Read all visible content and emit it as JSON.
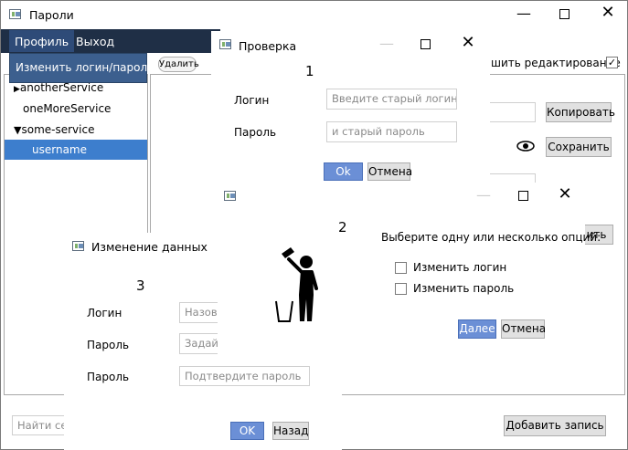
{
  "main": {
    "title": "Пароли",
    "menu": {
      "profile": "Профиль",
      "exit": "Выход"
    },
    "dropdown_item": "Изменить логин/пароль",
    "delete_button": "Удалить",
    "allow_edit_label": "шить редактирование",
    "tree": [
      {
        "label": "anotherService",
        "prefix": "▶"
      },
      {
        "label": "oneMoreService",
        "prefix": ""
      },
      {
        "label": "some-service",
        "prefix": "▼"
      },
      {
        "label": "username",
        "prefix": ""
      }
    ],
    "copy_button": "Копировать",
    "save_button": "Сохранить",
    "partial_button": "ить",
    "search_placeholder": "Найти сер",
    "add_button": "Добавить запись"
  },
  "dialog1": {
    "title": "Проверка",
    "number": "1",
    "login_label": "Логин",
    "password_label": "Пароль",
    "login_placeholder": "Введите старый логин",
    "password_placeholder": "и старый пароль",
    "ok": "Ok",
    "cancel": "Отмена"
  },
  "dialog2": {
    "number": "2",
    "prompt": "Выберите одну или несколько опций:",
    "options": [
      "Изменить логин",
      "Изменить пароль"
    ],
    "next": "Далее",
    "cancel": "Отмена"
  },
  "dialog3": {
    "title": "Изменение данных",
    "number": "3",
    "login_label": "Логин",
    "password_label": "Пароль",
    "confirm_label": "Пароль",
    "login_placeholder": "Назов",
    "password_placeholder": "Задай",
    "confirm_placeholder": "Подтвердите пароль",
    "ok": "OK",
    "back": "Назад"
  }
}
